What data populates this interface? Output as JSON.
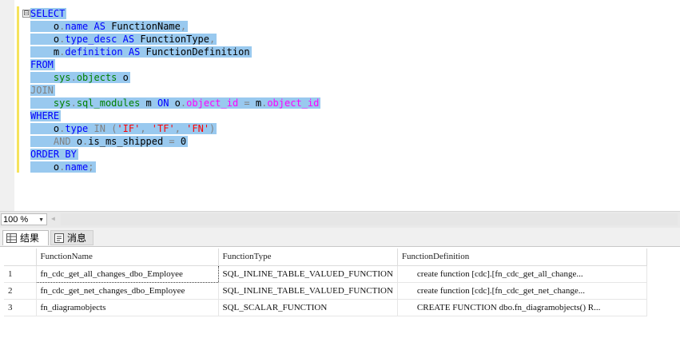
{
  "editor": {
    "collapse_symbol": "⊟",
    "lines": [
      [
        {
          "t": "SELECT",
          "c": "kw"
        }
      ],
      [
        {
          "t": "    ",
          "c": "pl"
        },
        {
          "t": "o",
          "c": "pl"
        },
        {
          "t": ".",
          "c": "gr"
        },
        {
          "t": "name",
          "c": "kw"
        },
        {
          "t": " AS ",
          "c": "kw"
        },
        {
          "t": "FunctionName",
          "c": "pl"
        },
        {
          "t": ",",
          "c": "gr"
        }
      ],
      [
        {
          "t": "    ",
          "c": "pl"
        },
        {
          "t": "o",
          "c": "pl"
        },
        {
          "t": ".",
          "c": "gr"
        },
        {
          "t": "type_desc",
          "c": "kw"
        },
        {
          "t": " AS ",
          "c": "kw"
        },
        {
          "t": "FunctionType",
          "c": "pl"
        },
        {
          "t": ",",
          "c": "gr"
        }
      ],
      [
        {
          "t": "    ",
          "c": "pl"
        },
        {
          "t": "m",
          "c": "pl"
        },
        {
          "t": ".",
          "c": "gr"
        },
        {
          "t": "definition",
          "c": "kw"
        },
        {
          "t": " AS ",
          "c": "kw"
        },
        {
          "t": "FunctionDefinition",
          "c": "pl"
        }
      ],
      [
        {
          "t": "FROM",
          "c": "kw"
        }
      ],
      [
        {
          "t": "    ",
          "c": "pl"
        },
        {
          "t": "sys",
          "c": "sys"
        },
        {
          "t": ".",
          "c": "gr"
        },
        {
          "t": "objects",
          "c": "sys"
        },
        {
          "t": " o",
          "c": "pl"
        }
      ],
      [
        {
          "t": "JOIN",
          "c": "gr"
        }
      ],
      [
        {
          "t": "    ",
          "c": "pl"
        },
        {
          "t": "sys",
          "c": "sys"
        },
        {
          "t": ".",
          "c": "gr"
        },
        {
          "t": "sql_modules",
          "c": "sys"
        },
        {
          "t": " m ",
          "c": "pl"
        },
        {
          "t": "ON",
          "c": "kw"
        },
        {
          "t": " o",
          "c": "pl"
        },
        {
          "t": ".",
          "c": "gr"
        },
        {
          "t": "object_id",
          "c": "fn"
        },
        {
          "t": " = ",
          "c": "gr"
        },
        {
          "t": "m",
          "c": "pl"
        },
        {
          "t": ".",
          "c": "gr"
        },
        {
          "t": "object_id",
          "c": "fn"
        }
      ],
      [
        {
          "t": "WHERE",
          "c": "kw"
        }
      ],
      [
        {
          "t": "    ",
          "c": "pl"
        },
        {
          "t": "o",
          "c": "pl"
        },
        {
          "t": ".",
          "c": "gr"
        },
        {
          "t": "type",
          "c": "kw"
        },
        {
          "t": " IN ",
          "c": "gr"
        },
        {
          "t": "(",
          "c": "gr"
        },
        {
          "t": "'IF'",
          "c": "str"
        },
        {
          "t": ", ",
          "c": "gr"
        },
        {
          "t": "'TF'",
          "c": "str"
        },
        {
          "t": ", ",
          "c": "gr"
        },
        {
          "t": "'FN'",
          "c": "str"
        },
        {
          "t": ")",
          "c": "gr"
        }
      ],
      [
        {
          "t": "    ",
          "c": "pl"
        },
        {
          "t": "AND",
          "c": "gr"
        },
        {
          "t": " o",
          "c": "pl"
        },
        {
          "t": ".",
          "c": "gr"
        },
        {
          "t": "is_ms_shipped",
          "c": "pl"
        },
        {
          "t": " = ",
          "c": "gr"
        },
        {
          "t": "0",
          "c": "pl"
        }
      ],
      [
        {
          "t": "ORDER BY",
          "c": "kw"
        }
      ],
      [
        {
          "t": "    ",
          "c": "pl"
        },
        {
          "t": "o",
          "c": "pl"
        },
        {
          "t": ".",
          "c": "gr"
        },
        {
          "t": "name",
          "c": "kw"
        },
        {
          "t": ";",
          "c": "gr"
        }
      ]
    ]
  },
  "zoom": {
    "value": "100 %",
    "dropdown_icon": "chevron-down-icon"
  },
  "tabs": [
    {
      "label": "结果",
      "icon": "grid-icon"
    },
    {
      "label": "消息",
      "icon": "message-icon"
    }
  ],
  "results": {
    "columns": [
      "",
      "FunctionName",
      "FunctionType",
      "FunctionDefinition"
    ],
    "rows": [
      [
        "1",
        "fn_cdc_get_all_changes_dbo_Employee",
        "SQL_INLINE_TABLE_VALUED_FUNCTION",
        "create function [cdc].[fn_cdc_get_all_change..."
      ],
      [
        "2",
        "fn_cdc_get_net_changes_dbo_Employee",
        "SQL_INLINE_TABLE_VALUED_FUNCTION",
        "create function [cdc].[fn_cdc_get_net_change..."
      ],
      [
        "3",
        "fn_diagramobjects",
        "SQL_SCALAR_FUNCTION",
        "CREATE FUNCTION dbo.fn_diagramobjects()     R..."
      ]
    ]
  },
  "colors": {
    "selection": "#99c9ef",
    "keyword": "#0000ff",
    "system": "#008000",
    "function": "#ff00ff",
    "string": "#ff0000",
    "gray": "#808080"
  }
}
